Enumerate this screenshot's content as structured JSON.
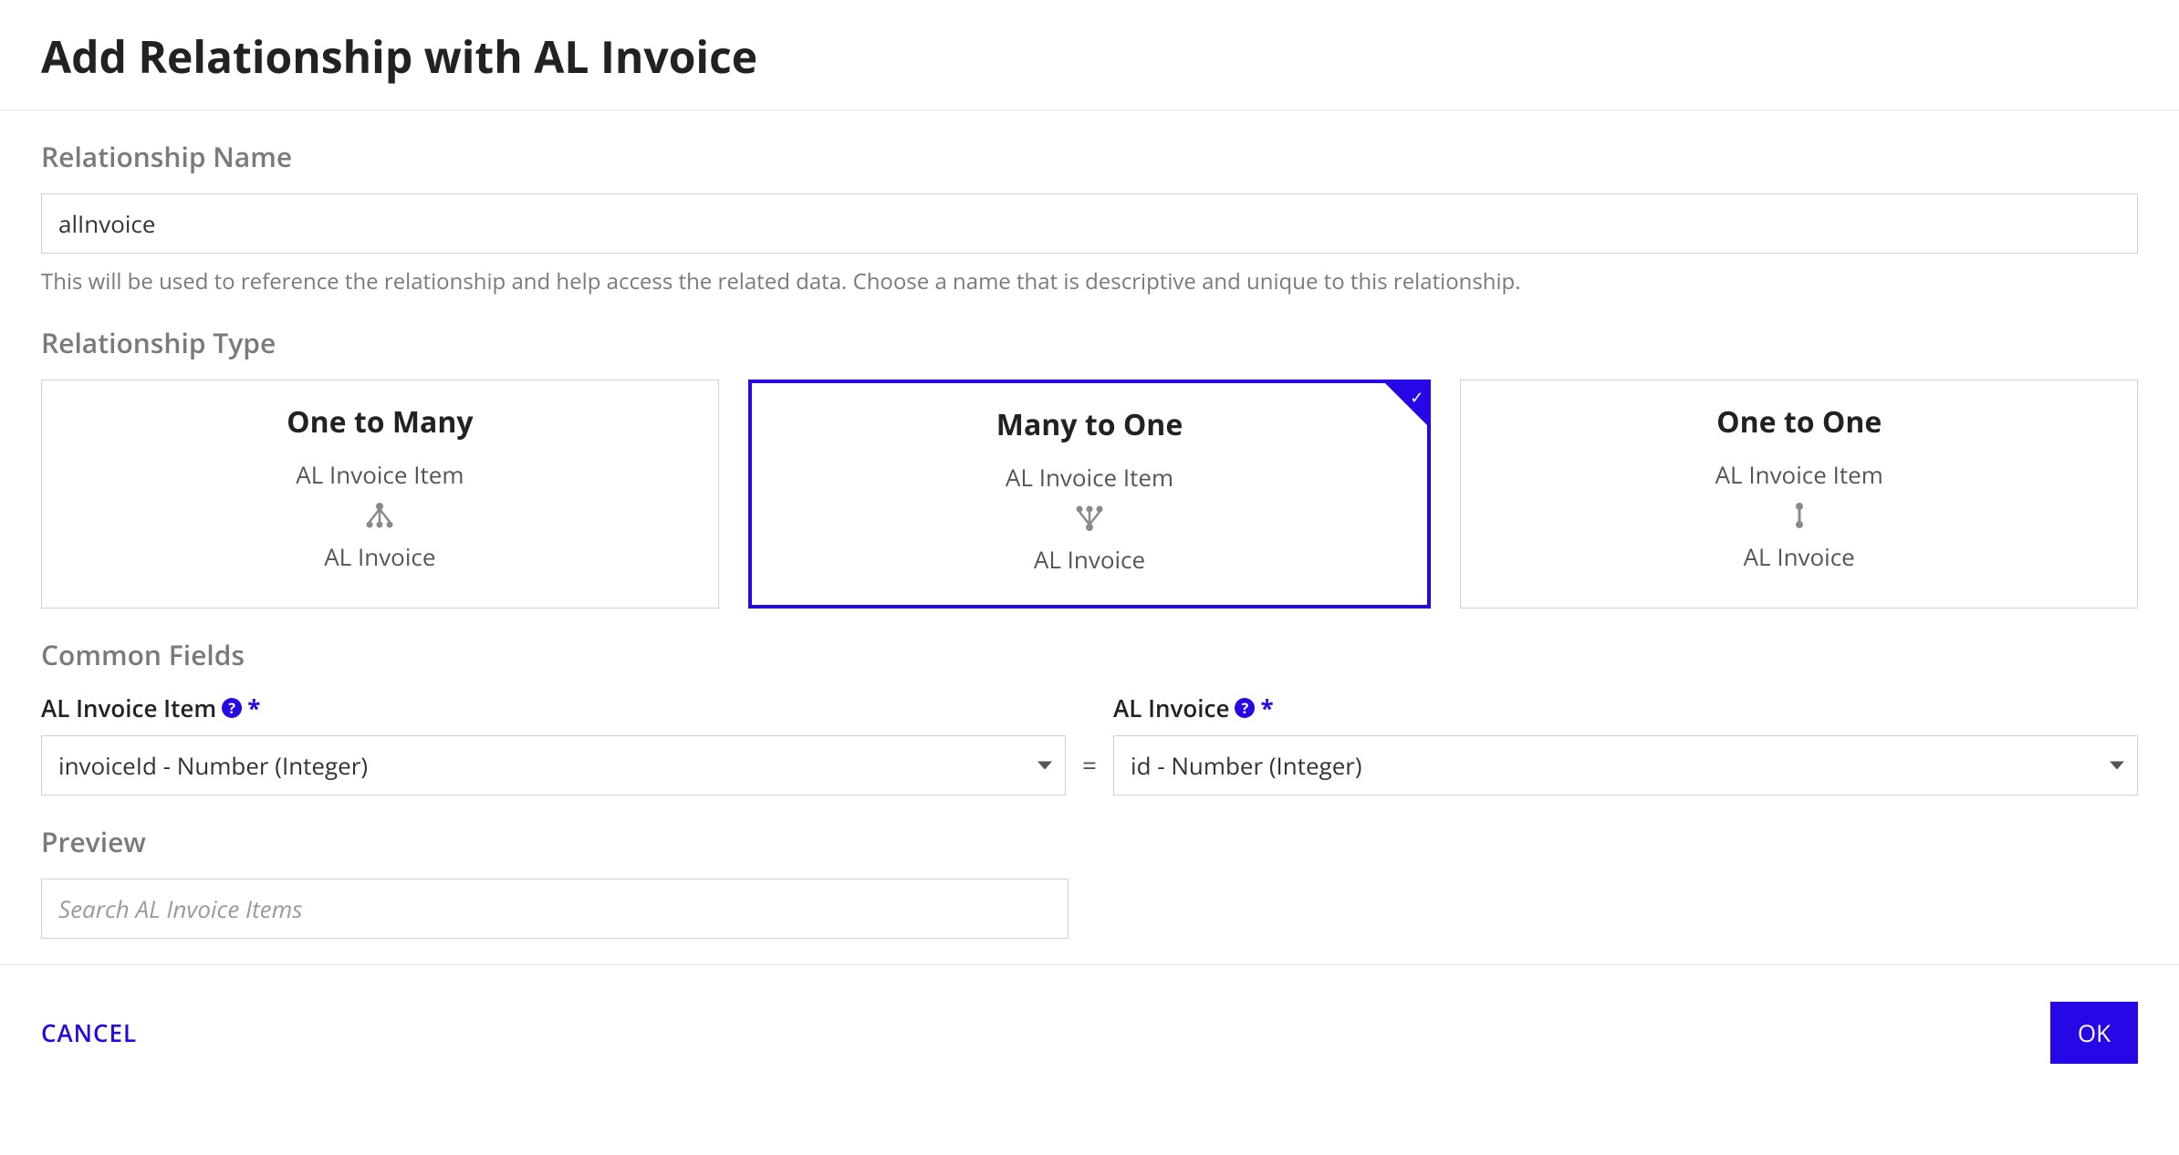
{
  "header": {
    "title": "Add Relationship with AL Invoice"
  },
  "sections": {
    "name_label": "Relationship Name",
    "name_value": "alInvoice",
    "name_help": "This will be used to reference the relationship and help access the related data. Choose a name that is descriptive and unique to this relationship.",
    "type_label": "Relationship Type",
    "common_label": "Common Fields",
    "preview_label": "Preview",
    "preview_placeholder": "Search AL Invoice Items"
  },
  "types": [
    {
      "title": "One to Many",
      "from": "AL Invoice Item",
      "to": "AL Invoice",
      "selected": false
    },
    {
      "title": "Many to One",
      "from": "AL Invoice Item",
      "to": "AL Invoice",
      "selected": true
    },
    {
      "title": "One to One",
      "from": "AL Invoice Item",
      "to": "AL Invoice",
      "selected": false
    }
  ],
  "fields": {
    "left_label": "AL Invoice Item",
    "left_value": "invoiceId - Number (Integer)",
    "equals": "=",
    "right_label": "AL Invoice",
    "right_value": "id - Number (Integer)"
  },
  "footer": {
    "cancel": "CANCEL",
    "ok": "OK"
  },
  "icons": {
    "help_glyph": "?",
    "check_glyph": "✓"
  }
}
